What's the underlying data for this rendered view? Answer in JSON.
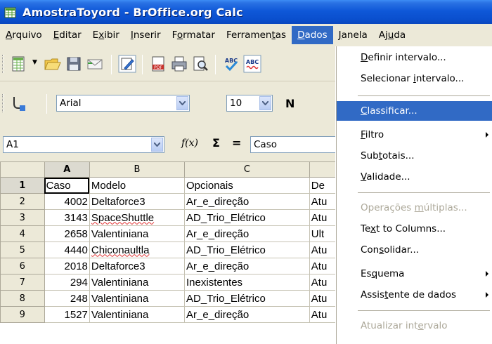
{
  "window": {
    "title": "AmostraToyord - BrOffice.org Calc"
  },
  "menubar": {
    "items": [
      {
        "label": "Arquivo",
        "name": "menu-arquivo"
      },
      {
        "label": "Editar",
        "name": "menu-editar"
      },
      {
        "label": "Exibir",
        "name": "menu-exibir"
      },
      {
        "label": "Inserir",
        "name": "menu-inserir"
      },
      {
        "label": "Formatar",
        "name": "menu-formatar"
      },
      {
        "label": "Ferramentas",
        "name": "menu-ferramentas"
      },
      {
        "label": "Dados",
        "name": "menu-dados",
        "active": true
      },
      {
        "label": "Janela",
        "name": "menu-janela"
      },
      {
        "label": "Ajuda",
        "name": "menu-ajuda"
      }
    ]
  },
  "format_toolbar": {
    "font_name": "Arial",
    "font_size": "10",
    "bold_label": "N"
  },
  "formula_bar": {
    "name_box": "A1",
    "fx_label": "f(x)",
    "sum_label": "Σ",
    "equals_label": "=",
    "content": "Caso"
  },
  "sheet": {
    "columns": [
      "A",
      "B",
      "C",
      ""
    ],
    "rows": [
      {
        "n": "1",
        "cells": [
          "Caso",
          "Modelo",
          "Opcionais",
          "De"
        ]
      },
      {
        "n": "2",
        "cells": [
          "4002",
          "Deltaforce3",
          "Ar_e_direção",
          "Atu"
        ]
      },
      {
        "n": "3",
        "cells": [
          "3143",
          "SpaceShuttle",
          "AD_Trio_Elétrico",
          "Atu"
        ]
      },
      {
        "n": "4",
        "cells": [
          "2658",
          "Valentiniana",
          "Ar_e_direção",
          "Ult"
        ]
      },
      {
        "n": "5",
        "cells": [
          "4440",
          "Chiconaultla",
          "AD_Trio_Elétrico",
          "Atu"
        ]
      },
      {
        "n": "6",
        "cells": [
          "2018",
          "Deltaforce3",
          "Ar_e_direção",
          "Atu"
        ]
      },
      {
        "n": "7",
        "cells": [
          "294",
          "Valentiniana",
          "Inexistentes",
          "Atu"
        ]
      },
      {
        "n": "8",
        "cells": [
          "248",
          "Valentiniana",
          "AD_Trio_Elétrico",
          "Atu"
        ]
      },
      {
        "n": "9",
        "cells": [
          "1527",
          "Valentiniana",
          "Ar_e_direção",
          "Atu"
        ]
      }
    ]
  },
  "dados_menu": {
    "items": [
      {
        "label": "Definir intervalo...",
        "name": "menu-definir-intervalo"
      },
      {
        "label": "Selecionar intervalo...",
        "name": "menu-selecionar-intervalo"
      },
      {
        "label": "Classificar...",
        "name": "menu-classificar",
        "highlight": true
      },
      {
        "label": "Filtro",
        "name": "menu-filtro",
        "submenu": true
      },
      {
        "label": "Subtotais...",
        "name": "menu-subtotais"
      },
      {
        "label": "Validade...",
        "name": "menu-validade"
      },
      {
        "label": "Operações múltiplas...",
        "name": "menu-operacoes-multiplas",
        "disabled": true
      },
      {
        "label": "Text to Columns...",
        "name": "menu-text-to-columns"
      },
      {
        "label": "Consolidar...",
        "name": "menu-consolidar"
      },
      {
        "label": "Esquema",
        "name": "menu-esquema",
        "submenu": true
      },
      {
        "label": "Assistente de dados",
        "name": "menu-assistente-de-dados",
        "submenu": true
      },
      {
        "label": "Atualizar intervalo",
        "name": "menu-atualizar-intervalo",
        "disabled": true
      }
    ]
  },
  "colors": {
    "titlebar": "#0a58d8",
    "highlight": "#316ac5",
    "spellcheck": "#e03030"
  }
}
